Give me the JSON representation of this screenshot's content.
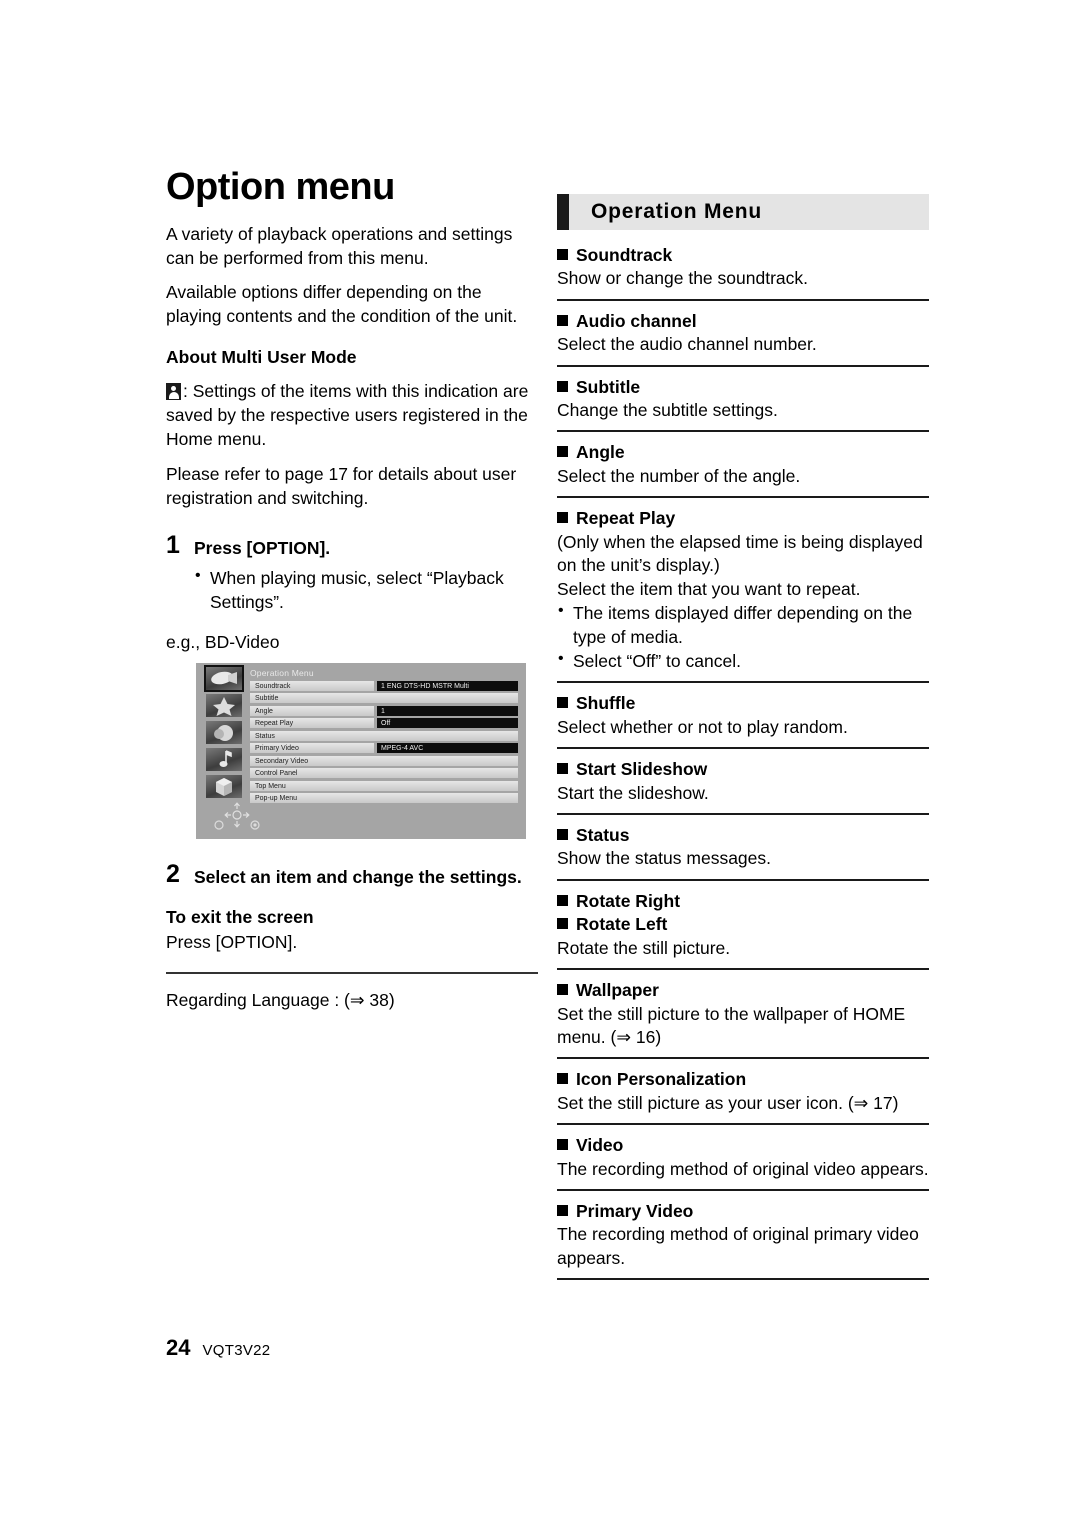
{
  "document": {
    "page_number": "24",
    "document_code": "VQT3V22"
  },
  "left_column": {
    "title": "Option menu",
    "intro_1": "A variety of playback operations and settings can be performed from this menu.",
    "intro_2": "Available options differ depending on the playing contents and the condition of the unit.",
    "multi_user": {
      "heading": "About Multi User Mode",
      "icon_name": "user-silhouette-icon",
      "text_1": ": Settings of the items with this indication are saved by the respective users registered in the Home menu.",
      "text_2": "Please refer to page 17 for details about user registration and switching."
    },
    "step1": {
      "number": "1",
      "title": "Press [OPTION].",
      "bullets": [
        "When playing music, select “Playback Settings”."
      ]
    },
    "example_label": "e.g., BD-Video",
    "device_screenshot": {
      "menu_title": "Operation Menu",
      "rows": [
        {
          "label": "Soundtrack",
          "value": "1 ENG DTS-HD MSTR Multi"
        },
        {
          "label": "Subtitle",
          "value": ""
        },
        {
          "label": "Angle",
          "value": "1"
        },
        {
          "label": "Repeat Play",
          "value": "Off"
        },
        {
          "label": "Status",
          "value": ""
        },
        {
          "label": "Primary Video",
          "value": "MPEG-4 AVC"
        },
        {
          "label": "Secondary Video",
          "value": ""
        },
        {
          "label": "Control Panel",
          "value": ""
        },
        {
          "label": "Top Menu",
          "value": ""
        },
        {
          "label": "Pop-up Menu",
          "value": ""
        }
      ],
      "thumbnails": [
        "video-thumbnail-icon",
        "star-thumbnail-icon",
        "sphere-thumbnail-icon",
        "music-note-thumbnail-icon",
        "cube-thumbnail-icon"
      ],
      "dpad_icon": "dpad-cursor-icon"
    },
    "step2": {
      "number": "2",
      "title": "Select an item and change the settings."
    },
    "exit": {
      "heading": "To exit the screen",
      "text": "Press [OPTION]."
    },
    "regarding_language": "Regarding Language : (⇒ 38)"
  },
  "right_column": {
    "banner_title": "Operation Menu",
    "entries": [
      {
        "title": "Soundtrack",
        "body": "Show or change the soundtrack.",
        "bullets": []
      },
      {
        "title": "Audio channel",
        "body": "Select the audio channel number.",
        "bullets": []
      },
      {
        "title": "Subtitle",
        "body": "Change the subtitle settings.",
        "bullets": []
      },
      {
        "title": "Angle",
        "body": "Select the number of the angle.",
        "bullets": []
      },
      {
        "title": "Repeat Play",
        "body": "(Only when the elapsed time is being displayed on the unit’s display.)\nSelect the item that you want to repeat.",
        "bullets": [
          "The items displayed differ depending on the type of media.",
          "Select “Off” to cancel."
        ]
      },
      {
        "title": "Shuffle",
        "body": "Select whether or not to play random.",
        "bullets": []
      },
      {
        "title": "Start Slideshow",
        "body": "Start the slideshow.",
        "bullets": []
      },
      {
        "title": "Status",
        "body": "Show the status messages.",
        "bullets": []
      },
      {
        "title": "Rotate Right",
        "title2": "Rotate Left",
        "body": "Rotate the still picture.",
        "bullets": []
      },
      {
        "title": "Wallpaper",
        "body": "Set the still picture to the wallpaper of HOME menu. (⇒ 16)",
        "bullets": []
      },
      {
        "title": "Icon Personalization",
        "body": "Set the still picture as your user icon. (⇒ 17)",
        "bullets": []
      },
      {
        "title": "Video",
        "body": "The recording method of original video appears.",
        "bullets": []
      },
      {
        "title": "Primary Video",
        "body": "The recording method of original primary video appears.",
        "bullets": []
      }
    ]
  }
}
